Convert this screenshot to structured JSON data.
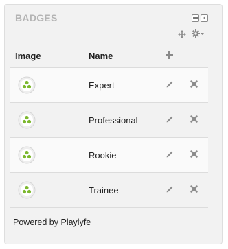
{
  "block": {
    "title": "BADGES",
    "footer": "Powered by Playlyfe"
  },
  "table": {
    "headers": {
      "image": "Image",
      "name": "Name"
    },
    "rows": [
      {
        "name": "Expert"
      },
      {
        "name": "Professional"
      },
      {
        "name": "Rookie"
      },
      {
        "name": "Trainee"
      }
    ]
  },
  "icons": {
    "minimize": "minimize-icon",
    "dock": "dock-icon",
    "move": "move-icon",
    "settings": "gear-icon",
    "add": "plus-icon",
    "edit": "pencil-icon",
    "delete": "close-icon",
    "badge": "badge-icon"
  },
  "colors": {
    "title": "#b4b4b4",
    "badge_green": "#7cb82f",
    "icon_gray": "#8a8a8a"
  }
}
